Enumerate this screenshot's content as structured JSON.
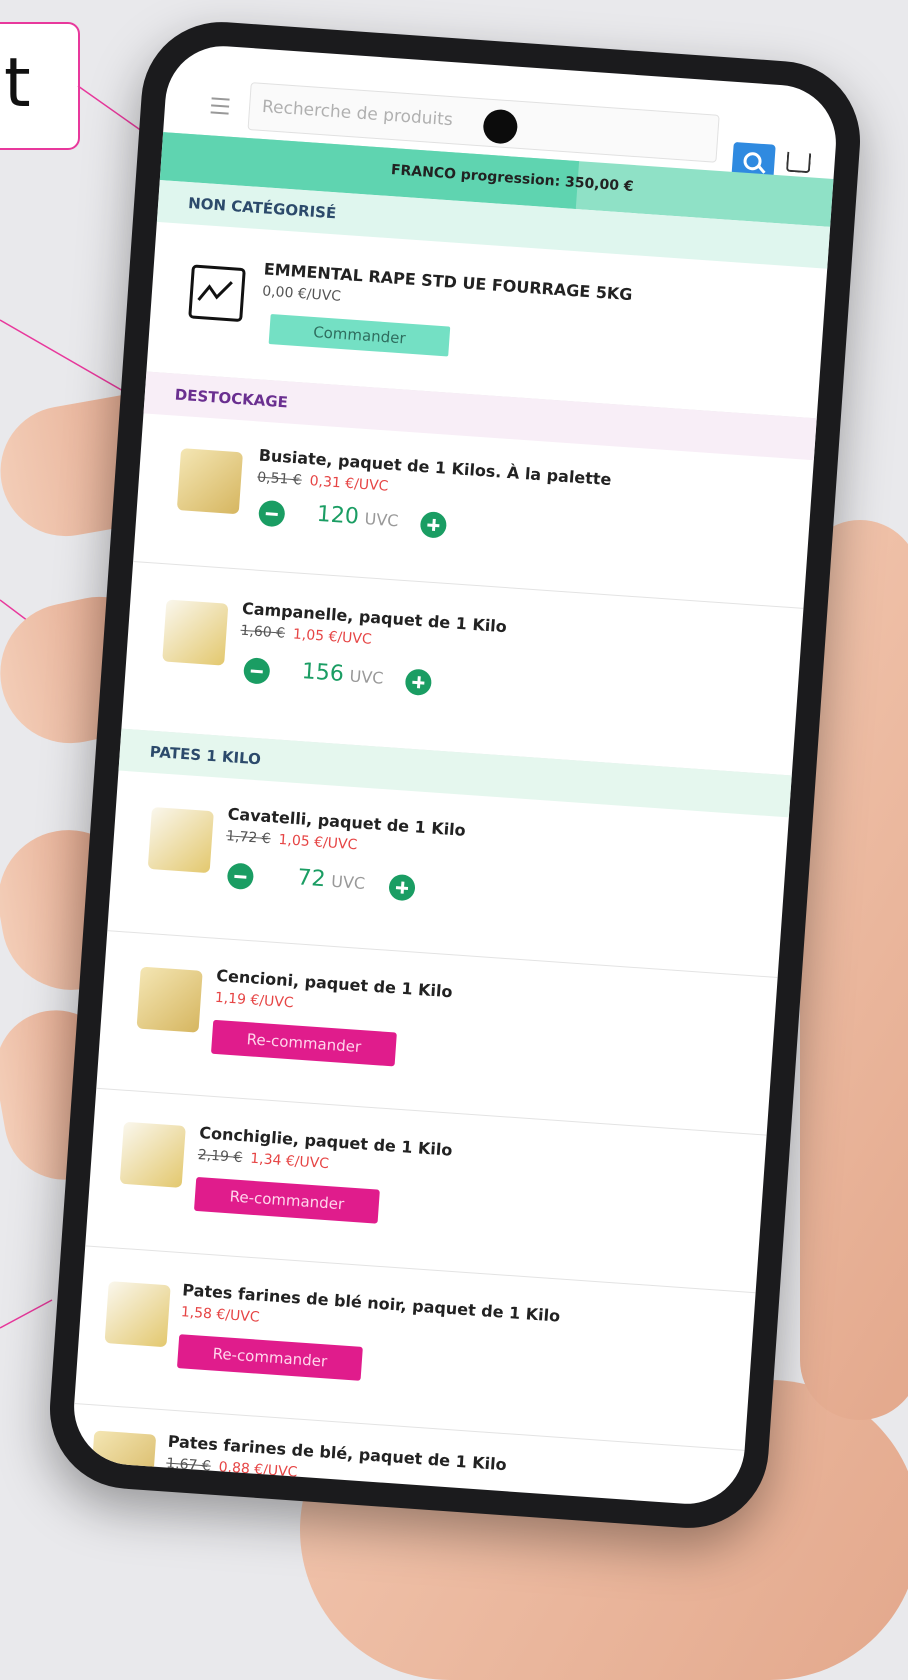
{
  "callout": {
    "text": "t"
  },
  "topbar": {
    "search_placeholder": "Recherche de produits"
  },
  "franco": {
    "label": "FRANCO progression: 350,00 €",
    "progress": 0.62
  },
  "sections": {
    "non_categorise": "NON CATÉGORISÉ",
    "destockage": "DESTOCKAGE",
    "pates": "PATES 1 KILO"
  },
  "items": {
    "emmental": {
      "name": "EMMENTAL RAPE STD UE FOURRAGE 5KG",
      "price": "0,00 €/UVC",
      "button": "Commander"
    },
    "busiate": {
      "name": "Busiate, paquet de 1 Kilos. À la palette",
      "old_price": "0,51 €",
      "price": "0,31 €/UVC",
      "qty": "120",
      "unit": "UVC"
    },
    "campanelle": {
      "name": "Campanelle, paquet de 1 Kilo",
      "old_price": "1,60 €",
      "price": "1,05 €/UVC",
      "qty": "156",
      "unit": "UVC"
    },
    "cavatelli": {
      "name": "Cavatelli, paquet de 1 Kilo",
      "old_price": "1,72 €",
      "price": "1,05 €/UVC",
      "qty": "72",
      "unit": "UVC"
    },
    "cencioni": {
      "name": "Cencioni, paquet de 1 Kilo",
      "price": "1,19 €/UVC",
      "button": "Re-commander"
    },
    "conchiglie": {
      "name": "Conchiglie, paquet de 1 Kilo",
      "old_price": "2,19 €",
      "price": "1,34 €/UVC",
      "button": "Re-commander"
    },
    "pates_ble_noir": {
      "name": "Pates farines de blé noir, paquet de 1 Kilo",
      "price": "1,58 €/UVC",
      "button": "Re-commander"
    },
    "pates_ble": {
      "name": "Pates farines de blé, paquet de 1 Kilo",
      "old_price": "1,67 €",
      "price": "0,88 €/UVC"
    }
  },
  "colors": {
    "accent_green": "#1a9d63",
    "commander_bg": "#74e0c4",
    "recommander_bg": "#e01c8c",
    "discount_red": "#e64545",
    "callout_border": "#e8389c"
  }
}
